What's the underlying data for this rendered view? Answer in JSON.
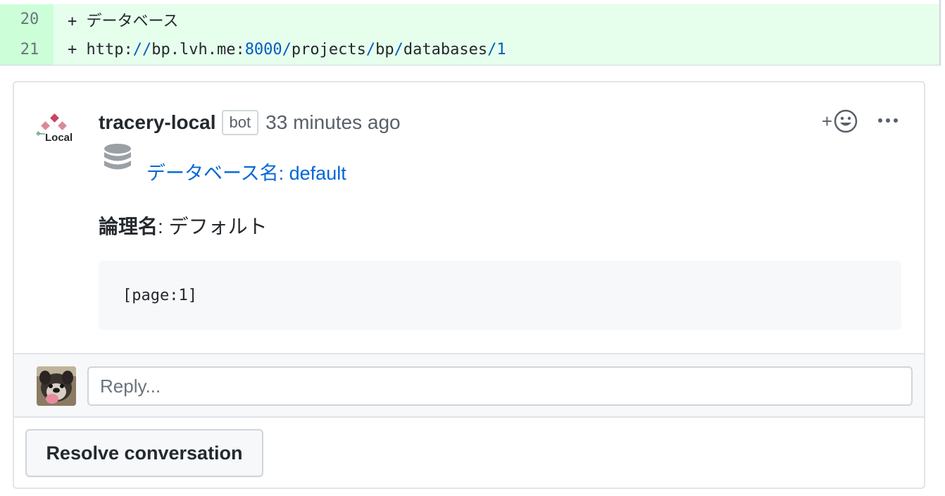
{
  "diff": {
    "lines": [
      {
        "number": "20",
        "prefix": "+ ",
        "text": "データベース"
      },
      {
        "number": "21",
        "prefix": "+ ",
        "url_parts": [
          "http:",
          "//",
          "bp.lvh.me:",
          "8000",
          "/",
          "projects",
          "/",
          "bp",
          "/",
          "databases",
          "/",
          "1"
        ]
      }
    ]
  },
  "comment": {
    "author": "tracery-local",
    "badge": "bot",
    "timestamp": "33 minutes ago",
    "avatar_text": "Local",
    "icons": {
      "reaction": "smiley-icon",
      "more": "kebab-horizontal-icon",
      "database": "database-icon"
    },
    "database_link": "データベース名: default",
    "logical_label": "論理名",
    "logical_value": ": デフォルト",
    "code": "[page:1]"
  },
  "reply": {
    "placeholder": "Reply..."
  },
  "resolve_button": "Resolve conversation",
  "colors": {
    "diff_bg": "#e6ffec",
    "diff_num_bg": "#ccffd8",
    "link": "#0366d6",
    "url_blue": "#005cc5"
  }
}
